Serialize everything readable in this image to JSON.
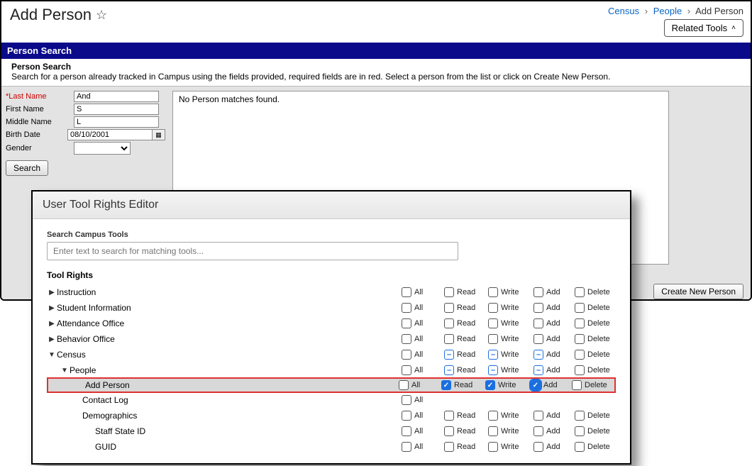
{
  "header": {
    "title": "Add Person",
    "breadcrumb": {
      "census": "Census",
      "people": "People",
      "current": "Add Person"
    },
    "related_tools": "Related Tools"
  },
  "section_bar": "Person Search",
  "search_desc": {
    "heading": "Person Search",
    "text": "Search for a person already tracked in Campus using the fields provided, required fields are in red. Select a person from the list or click on Create New Person."
  },
  "form": {
    "last_name": {
      "label": "*Last Name",
      "value": "And"
    },
    "first_name": {
      "label": "First Name",
      "value": "S"
    },
    "middle_name": {
      "label": "Middle Name",
      "value": "L"
    },
    "birth_date": {
      "label": "Birth Date",
      "value": "08/10/2001"
    },
    "gender": {
      "label": "Gender",
      "value": ""
    },
    "search_btn": "Search"
  },
  "results": {
    "empty": "No Person matches found."
  },
  "create_btn": "Create New Person",
  "overlay": {
    "title": "User Tool Rights Editor",
    "search_label": "Search Campus Tools",
    "search_placeholder": "Enter text to search for matching tools...",
    "tool_rights": "Tool Rights",
    "perms": {
      "all": "All",
      "read": "Read",
      "write": "Write",
      "add": "Add",
      "delete": "Delete"
    },
    "rows": {
      "instruction": "Instruction",
      "student_info": "Student Information",
      "attendance": "Attendance Office",
      "behavior": "Behavior Office",
      "census": "Census",
      "people": "People",
      "add_person": "Add Person",
      "contact_log": "Contact Log",
      "demographics": "Demographics",
      "staff_state_id": "Staff State ID",
      "guid": "GUID"
    }
  }
}
